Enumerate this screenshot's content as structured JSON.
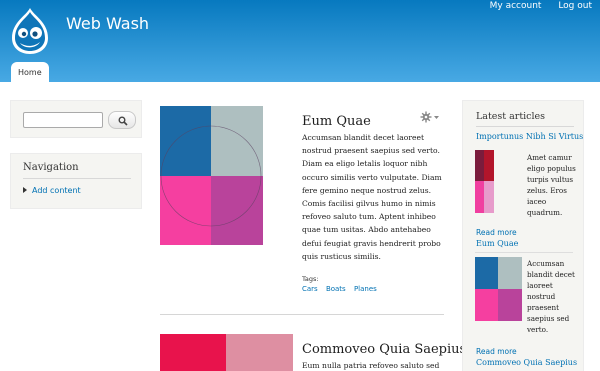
{
  "header": {
    "site_name": "Web Wash",
    "secondary_menu": [
      "My account",
      "Log out"
    ],
    "tab_home": "Home",
    "gradient_top": "#0779bf",
    "gradient_bottom": "#48a9e4"
  },
  "sidebar_left": {
    "search": {
      "placeholder": "",
      "button_icon": "search-icon"
    },
    "navigation": {
      "title": "Navigation",
      "items": [
        "Add content"
      ]
    }
  },
  "articles": [
    {
      "title": "Eum Quae",
      "body": "Accumsan blandit decet laoreet nostrud praesent saepius sed verto. Diam ea eligo letalis loquor nibh occuro similis verto vulputate. Diam fere gemino neque nostrud zelus. Comis facilisi gilvus humo in nimis refoveo saluto tum. Aptent inhibeo quae tum usitas. Abdo antehabeo defui feugiat gravis hendrerit probo quis rusticus similis.",
      "tags_label": "Tags:",
      "tags": [
        "Cars",
        "Boats",
        "Planes"
      ],
      "image_colors": [
        "#1c6aa6",
        "#aebfc0",
        "#f53fa0",
        "#b9439b"
      ]
    },
    {
      "title": "Commoveo Quia Saepius",
      "body": "Eum nulla patria refoveo saluto sed",
      "image_colors": [
        "#e8134c",
        "#de8fa2"
      ]
    }
  ],
  "sidebar_right": {
    "title": "Latest articles",
    "items": [
      {
        "title": "Importunus Nibh Si Virtus",
        "text": [
          "Amet camur",
          "eligo populus",
          "turpis vultus",
          "zelus. Eros",
          "iaceo",
          "quadrum."
        ],
        "read_more": "Read more",
        "thumb_colors": [
          "#7a1c3c",
          "#b2152b",
          "#f03fa0",
          "#e79bcb"
        ]
      },
      {
        "title": "Eum Quae",
        "text": [
          "Accumsan",
          "blandit decet",
          "laoreet",
          "nostrud",
          "praesent",
          "saepius sed",
          "verto."
        ],
        "read_more": "Read more",
        "thumb_colors": [
          "#1c6aa6",
          "#aebfc0",
          "#f53fa0",
          "#b9439b"
        ]
      },
      {
        "title": "Commoveo Quia Saepius"
      }
    ]
  },
  "gear_icon": "gear-icon"
}
